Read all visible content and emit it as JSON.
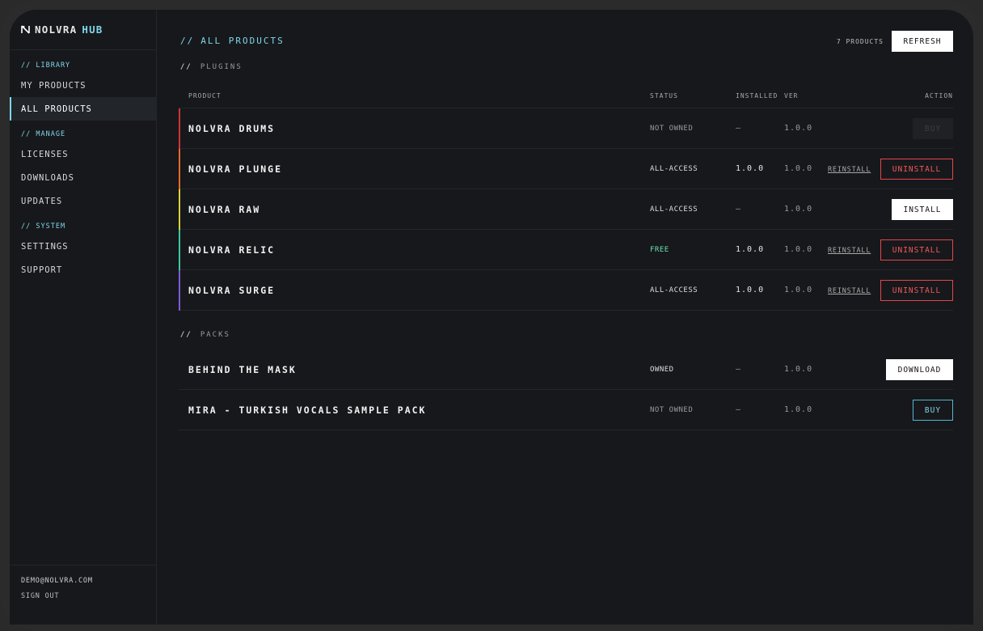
{
  "brand": {
    "name": "NOLVRA",
    "suffix": "HUB",
    "logo_icon": "nolvra-logo-icon"
  },
  "sidebar": {
    "sections": [
      {
        "label": "// LIBRARY",
        "items": [
          "MY PRODUCTS",
          "ALL PRODUCTS"
        ]
      },
      {
        "label": "// MANAGE",
        "items": [
          "LICENSES",
          "DOWNLOADS",
          "UPDATES"
        ]
      },
      {
        "label": "// SYSTEM",
        "items": [
          "SETTINGS",
          "SUPPORT"
        ]
      }
    ],
    "active_item": "ALL PRODUCTS",
    "footer": {
      "email": "DEMO@NOLVRA.COM",
      "sign_out": "SIGN OUT"
    }
  },
  "header": {
    "slashes": "//",
    "title": "ALL PRODUCTS",
    "count": "7 PRODUCTS",
    "refresh_label": "REFRESH"
  },
  "columns": {
    "product": "PRODUCT",
    "status": "STATUS",
    "installed": "INSTALLED",
    "ver": "VER",
    "action": "ACTION"
  },
  "plugins": {
    "slashes": "//",
    "label": "PLUGINS",
    "rows": [
      {
        "name": "NOLVRA DRUMS",
        "status": "NOT OWNED",
        "installed": "—",
        "ver": "1.0.0",
        "accent": "#d0343a",
        "action": "BUY"
      },
      {
        "name": "NOLVRA PLUNGE",
        "status": "ALL-ACCESS",
        "installed": "1.0.0",
        "ver": "1.0.0",
        "accent": "#e46a2c",
        "reinstall": "REINSTALL",
        "action": "UNINSTALL"
      },
      {
        "name": "NOLVRA RAW",
        "status": "ALL-ACCESS",
        "installed": "—",
        "ver": "1.0.0",
        "accent": "#d7d43a",
        "action": "INSTALL"
      },
      {
        "name": "NOLVRA RELIC",
        "status": "FREE",
        "installed": "1.0.0",
        "ver": "1.0.0",
        "accent": "#3cc9a0",
        "reinstall": "REINSTALL",
        "action": "UNINSTALL"
      },
      {
        "name": "NOLVRA SURGE",
        "status": "ALL-ACCESS",
        "installed": "1.0.0",
        "ver": "1.0.0",
        "accent": "#7d5bd6",
        "reinstall": "REINSTALL",
        "action": "UNINSTALL"
      }
    ]
  },
  "packs": {
    "slashes": "//",
    "label": "PACKS",
    "rows": [
      {
        "name": "BEHIND THE MASK",
        "status": "OWNED",
        "installed": "—",
        "ver": "1.0.0",
        "action": "DOWNLOAD"
      },
      {
        "name": "MIRA - TURKISH VOCALS SAMPLE PACK",
        "status": "NOT OWNED",
        "installed": "—",
        "ver": "1.0.0",
        "action": "BUY"
      }
    ]
  },
  "colors": {
    "accent_cyan": "#7fd6ec",
    "danger": "#e2474b",
    "free": "#6fe3b2",
    "background": "#17181b"
  }
}
